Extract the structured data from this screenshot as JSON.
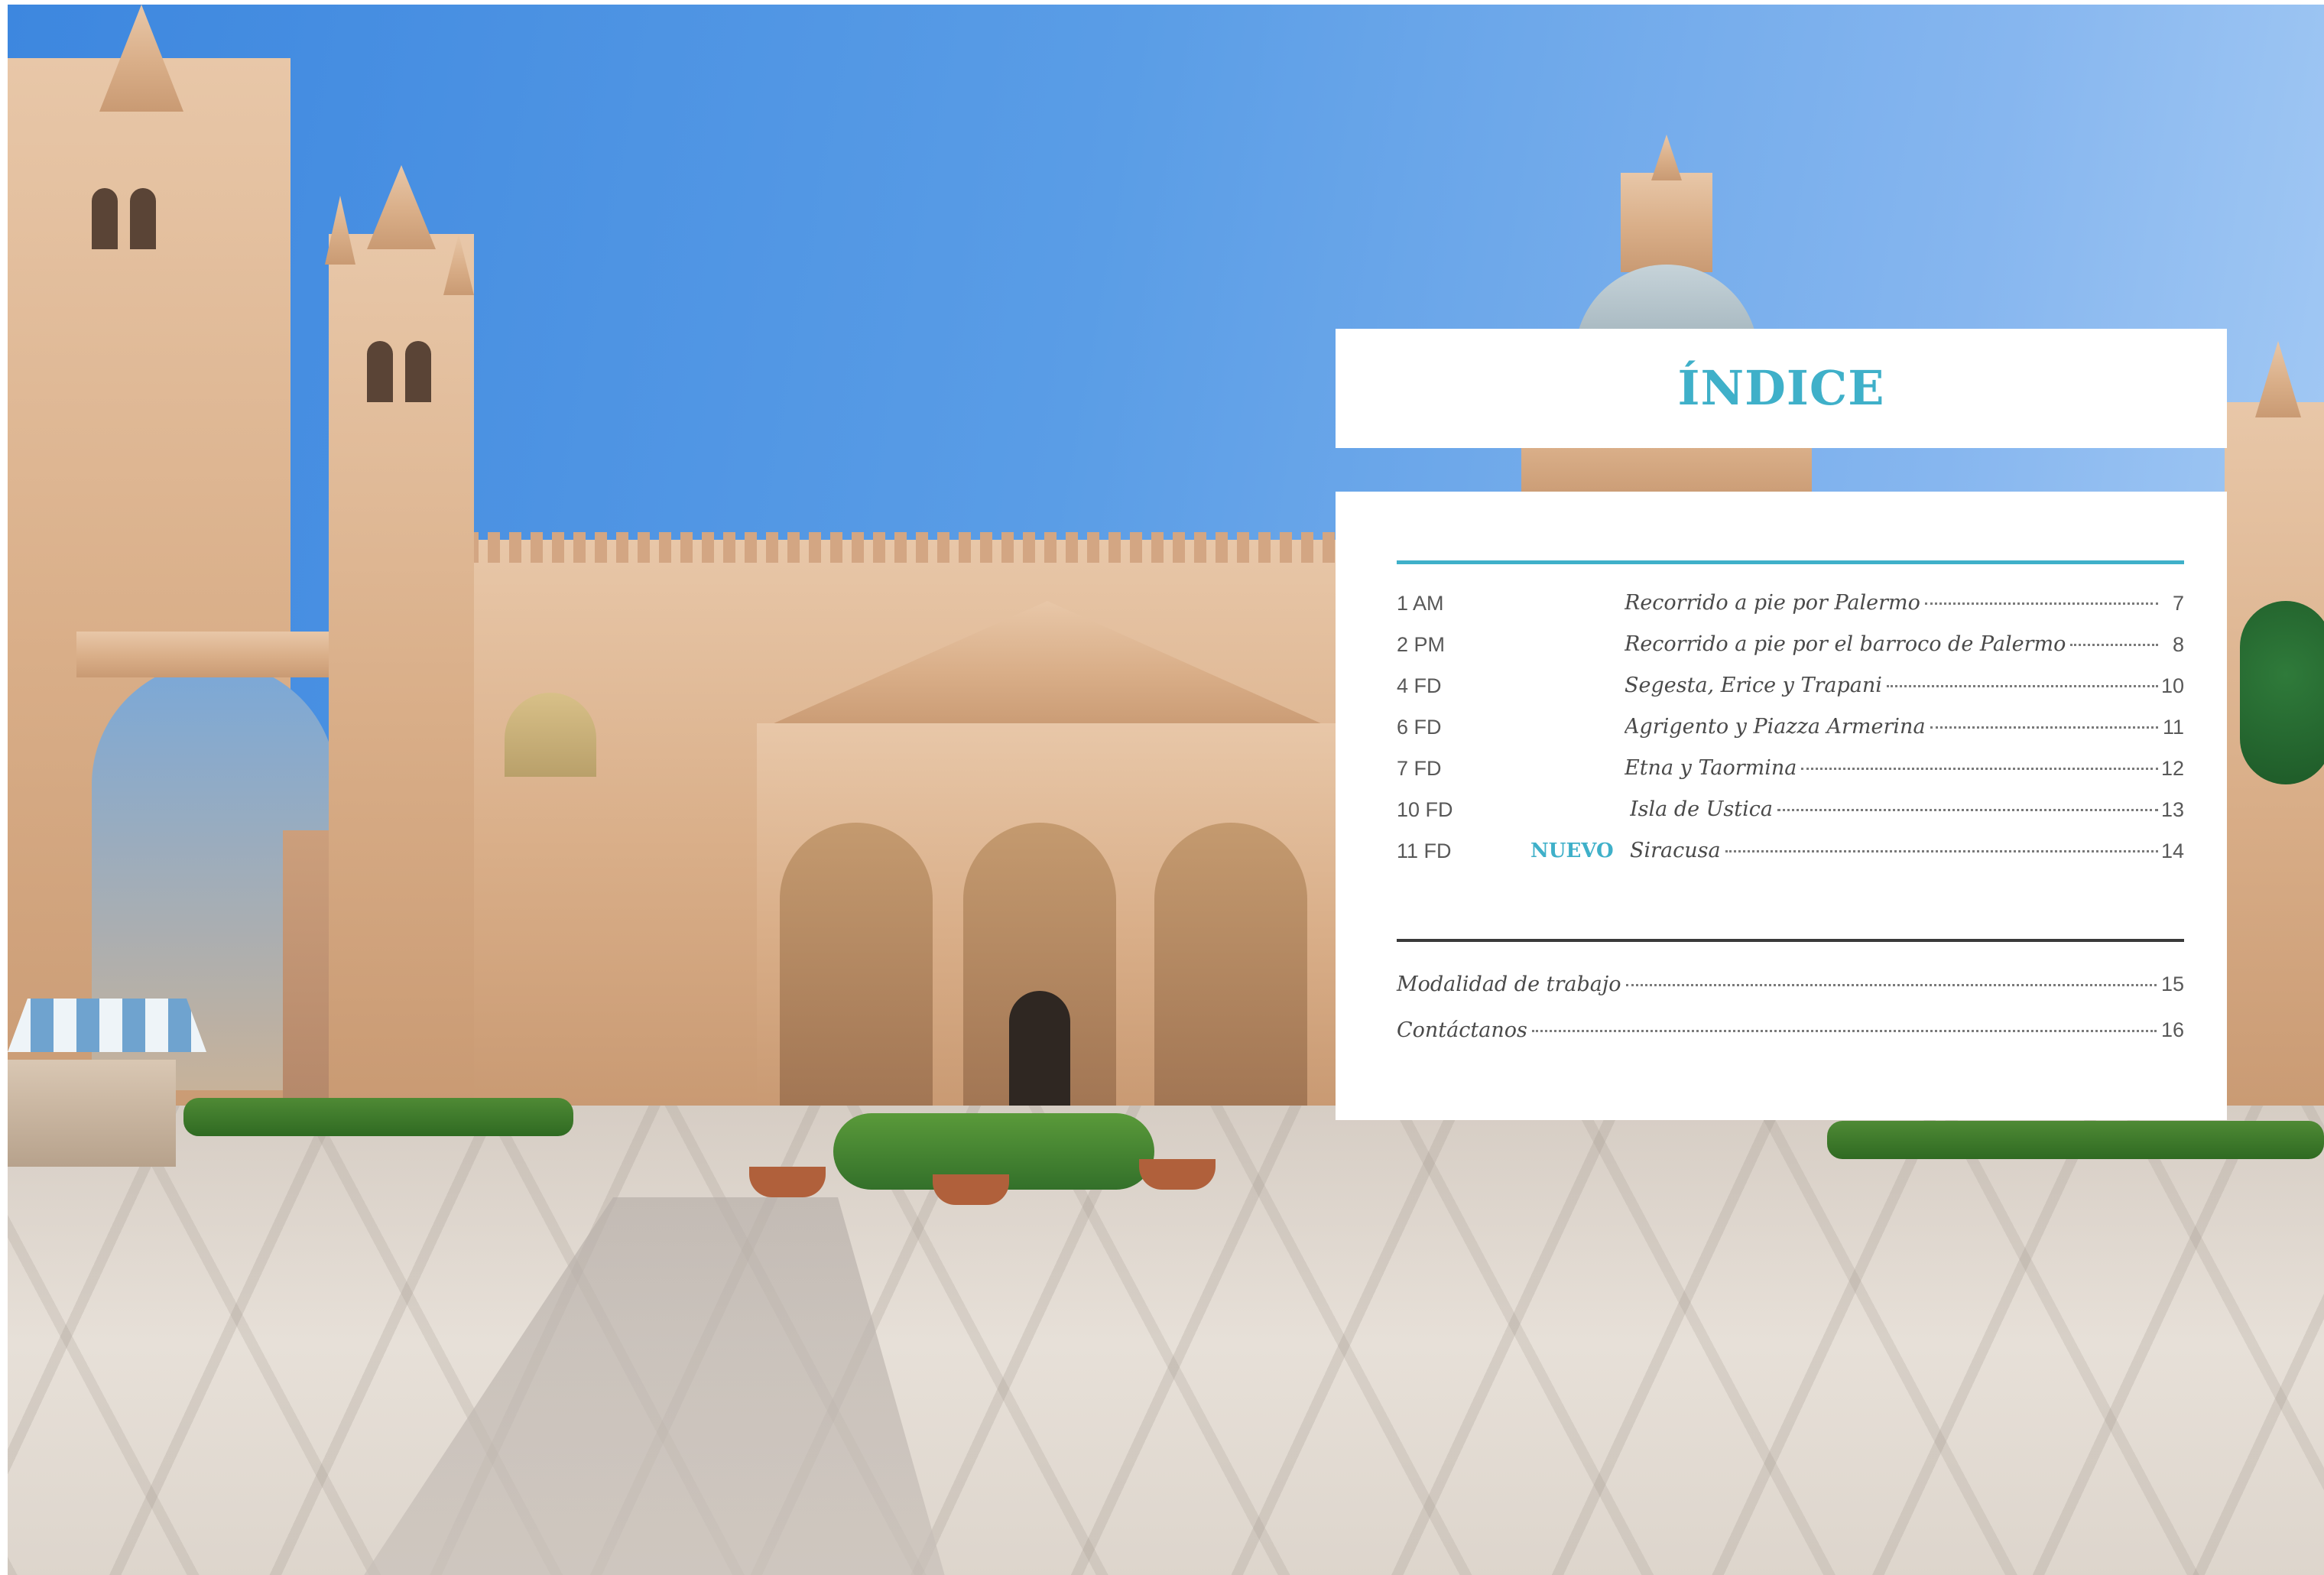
{
  "index": {
    "title": "ÍNDICE",
    "items": [
      {
        "code": "1 AM",
        "badge": "",
        "title": "Recorrido a pie por Palermo",
        "page": "7"
      },
      {
        "code": "2 PM",
        "badge": "",
        "title": "Recorrido a pie por el barroco de Palermo",
        "page": "8"
      },
      {
        "code": "4 FD",
        "badge": "",
        "title": "Segesta, Erice y Trapani",
        "page": "10"
      },
      {
        "code": "6 FD",
        "badge": "",
        "title": "Agrigento y Piazza Armerina",
        "page": "11"
      },
      {
        "code": "7 FD",
        "badge": "",
        "title": "Etna y Taormina",
        "page": "12"
      },
      {
        "code": "10 FD",
        "badge": "",
        "title": "Isla de Ustica",
        "page": "13"
      },
      {
        "code": "11 FD",
        "badge": "NUEVO",
        "title": "Siracusa",
        "page": "14"
      }
    ],
    "extras": [
      {
        "title": "Modalidad de trabajo",
        "page": "15"
      },
      {
        "title": "Contáctanos",
        "page": "16"
      }
    ]
  },
  "colors": {
    "accent": "#3fb0c9",
    "text": "#4a4a4a",
    "rule": "#3a3a3a",
    "panel": "#ffffff"
  },
  "background": {
    "subject": "Palermo cathedral and paved piazza under blue sky"
  }
}
